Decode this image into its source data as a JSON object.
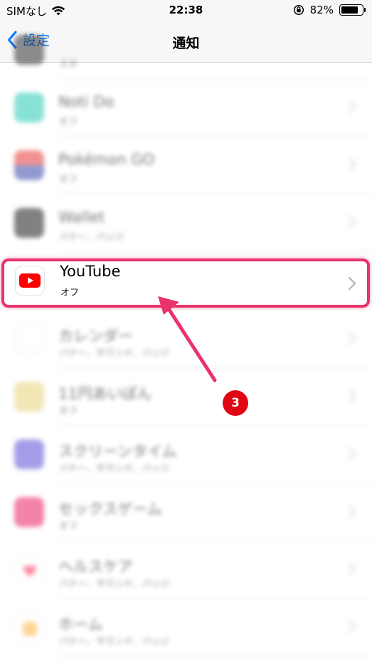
{
  "status_bar": {
    "carrier": "SIMなし",
    "time": "22:38",
    "battery": "82%",
    "battery_level": 0.82
  },
  "nav": {
    "back_label": "設定",
    "title": "通知"
  },
  "rows": [
    {
      "title": "",
      "subtitle": "スタ"
    },
    {
      "title": "Noti Do",
      "subtitle": "オフ"
    },
    {
      "title": "Pokémon GO",
      "subtitle": "オフ"
    },
    {
      "title": "Wallet",
      "subtitle": "バナー、バッジ"
    },
    {
      "title": "YouTube",
      "subtitle": "オフ"
    },
    {
      "title": "カレンダー",
      "subtitle": "バナー、サウンド、バッジ"
    },
    {
      "title": "11円あいぽん",
      "subtitle": "オフ"
    },
    {
      "title": "スクリーンタイム",
      "subtitle": "バナー、サウンド、バッジ"
    },
    {
      "title": "セックスゲーム",
      "subtitle": "オフ"
    },
    {
      "title": "ヘルスケア",
      "subtitle": "バナー、サウンド、バッジ"
    },
    {
      "title": "ホーム",
      "subtitle": "バナー、サウンド、バッジ"
    }
  ],
  "annotation": {
    "step_number": "3",
    "highlight_color": "#e8336b",
    "badge_color": "#e00613"
  },
  "icons": [
    "wifi-icon",
    "orientation-lock-icon",
    "battery-icon",
    "chevron-left-icon",
    "chevron-right-icon",
    "youtube-icon"
  ],
  "colors": {
    "accent": "#0a7aff",
    "youtube_red": "#ff0000"
  }
}
